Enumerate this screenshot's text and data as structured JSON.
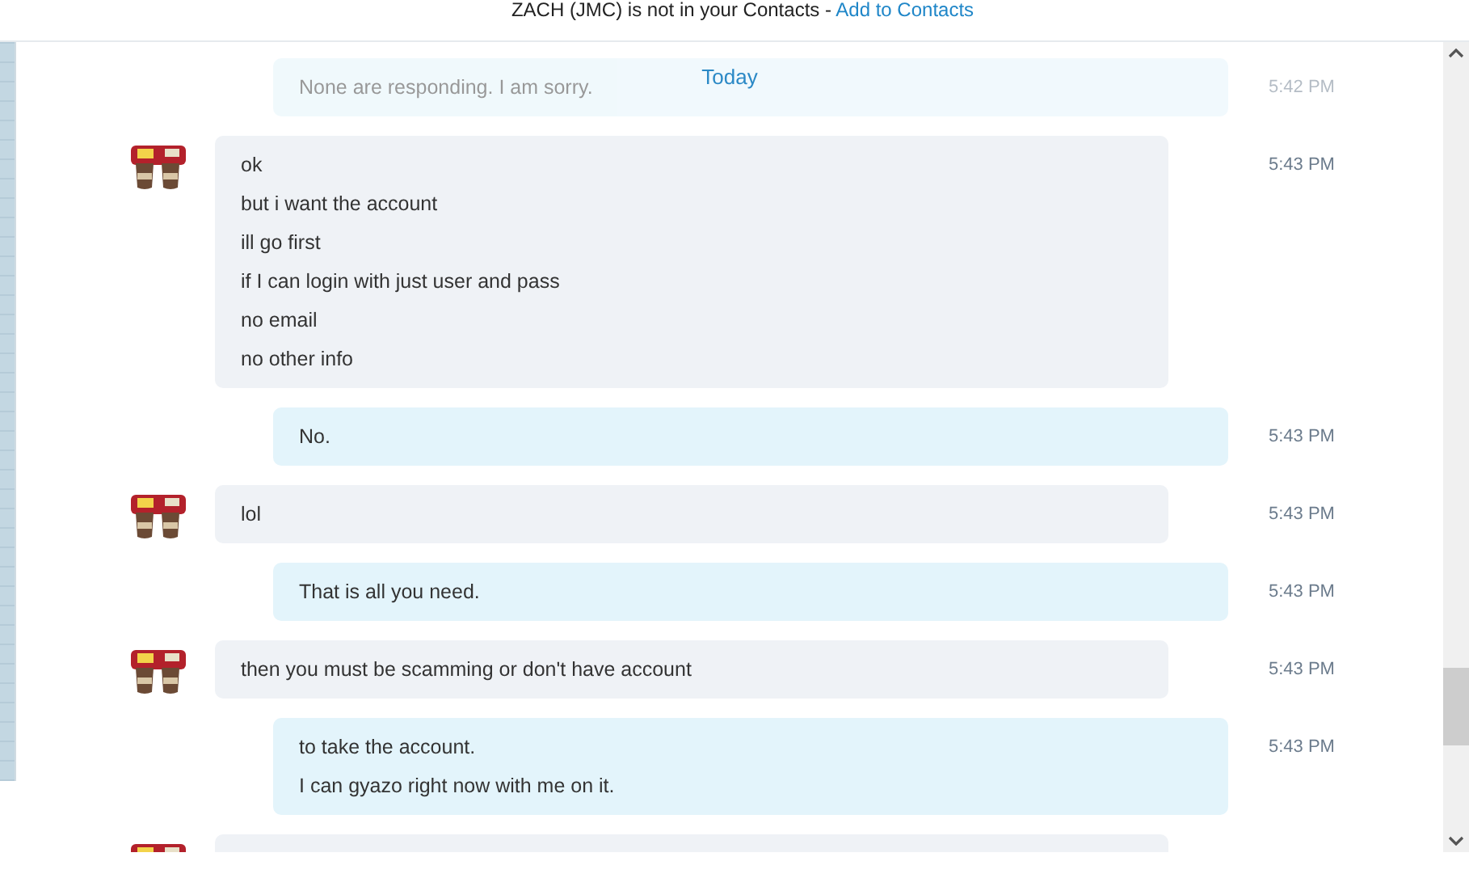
{
  "banner": {
    "text": "ZACH (JMC) is not in your Contacts - ",
    "link": "Add to Contacts"
  },
  "date_divider": "Today",
  "messages": [
    {
      "kind": "outgoing",
      "faded": true,
      "lines": [
        "None are responding. I am sorry."
      ],
      "time": "5:42 PM"
    },
    {
      "kind": "incoming",
      "faded": false,
      "lines": [
        "ok",
        "but i want the account",
        "ill go first",
        "if I can login with just user and pass",
        "no email",
        "no other info"
      ],
      "time": "5:43 PM"
    },
    {
      "kind": "outgoing",
      "faded": false,
      "lines": [
        "No."
      ],
      "time": "5:43 PM"
    },
    {
      "kind": "incoming",
      "faded": false,
      "lines": [
        "lol"
      ],
      "time": "5:43 PM"
    },
    {
      "kind": "outgoing",
      "faded": false,
      "lines": [
        "That is all you need."
      ],
      "time": "5:43 PM"
    },
    {
      "kind": "incoming",
      "faded": false,
      "lines": [
        "then you must be scamming or don't have account"
      ],
      "time": "5:43 PM"
    },
    {
      "kind": "outgoing",
      "faded": false,
      "lines": [
        "to take the account.",
        "I can gyazo right now with me on it."
      ],
      "time": "5:43 PM"
    },
    {
      "kind": "incoming",
      "faded": false
    }
  ]
}
